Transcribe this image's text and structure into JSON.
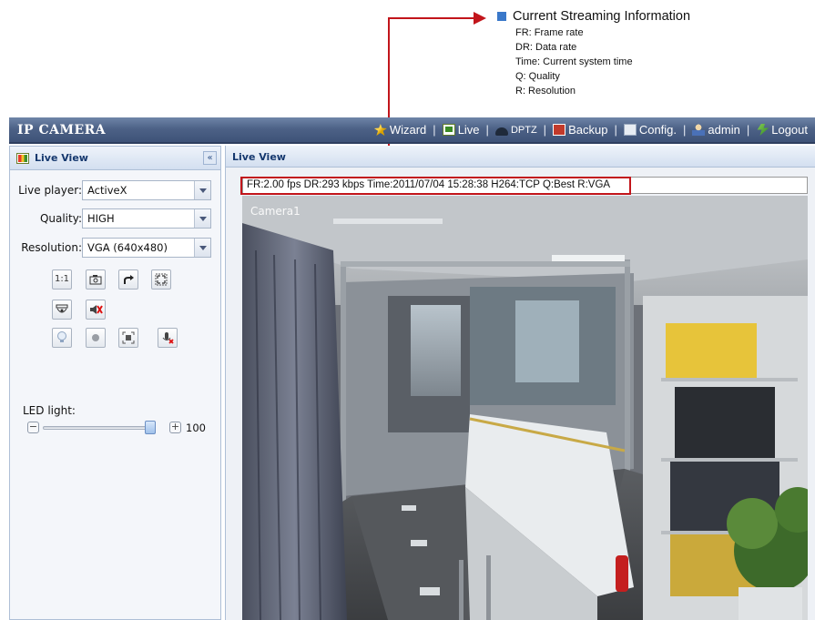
{
  "annotation": {
    "heading": "Current Streaming Information",
    "lines": [
      "FR: Frame rate",
      "DR: Data rate",
      "Time: Current system time",
      "Q: Quality",
      "R: Resolution"
    ],
    "color": "#c2151b",
    "bullet_color": "#3a78c9"
  },
  "header": {
    "brand": "IP CAMERA",
    "nav": [
      {
        "icon": "wizard-icon",
        "label": "Wizard"
      },
      {
        "icon": "live-icon",
        "label": "Live"
      },
      {
        "icon": "dptz-icon",
        "label": "DPTZ"
      },
      {
        "icon": "backup-icon",
        "label": "Backup"
      },
      {
        "icon": "config-icon",
        "label": "Config."
      },
      {
        "icon": "admin-icon",
        "label": "admin"
      },
      {
        "icon": "logout-icon",
        "label": "Logout"
      }
    ],
    "color": "#4d6287"
  },
  "left_panel": {
    "title": "Live View",
    "collapse_glyph": "«",
    "live_player": {
      "label": "Live player:",
      "value": "ActiveX"
    },
    "quality": {
      "label": "Quality:",
      "value": "HIGH"
    },
    "resolution": {
      "label": "Resolution:",
      "value": "VGA (640x480)"
    },
    "toolbar_row1": [
      {
        "icon": "actual-size-icon",
        "glyph": "1:1"
      },
      {
        "icon": "snapshot-icon",
        "glyph": ""
      },
      {
        "icon": "rotate-icon",
        "glyph": ""
      },
      {
        "icon": "fullscreen-icon",
        "glyph": ""
      }
    ],
    "toolbar_row2": [
      {
        "icon": "camera-dome-icon",
        "glyph": ""
      },
      {
        "icon": "speaker-mute-icon",
        "glyph": ""
      }
    ],
    "toolbar_row3": [
      {
        "icon": "light-bulb-icon",
        "glyph": ""
      },
      {
        "icon": "record-icon",
        "glyph": ""
      },
      {
        "icon": "zoom-focus-icon",
        "glyph": ""
      },
      {
        "icon": "microphone-mute-icon",
        "glyph": ""
      }
    ],
    "led": {
      "label": "LED light:",
      "value": 100,
      "minus": "−",
      "plus": "+"
    }
  },
  "right_panel": {
    "title": "Live View",
    "info_text": "FR:2.00 fps  DR:293 kbps Time:2011/07/04 15:28:38 H264:TCP Q:Best R:VGA",
    "video_label": "Camera1"
  }
}
